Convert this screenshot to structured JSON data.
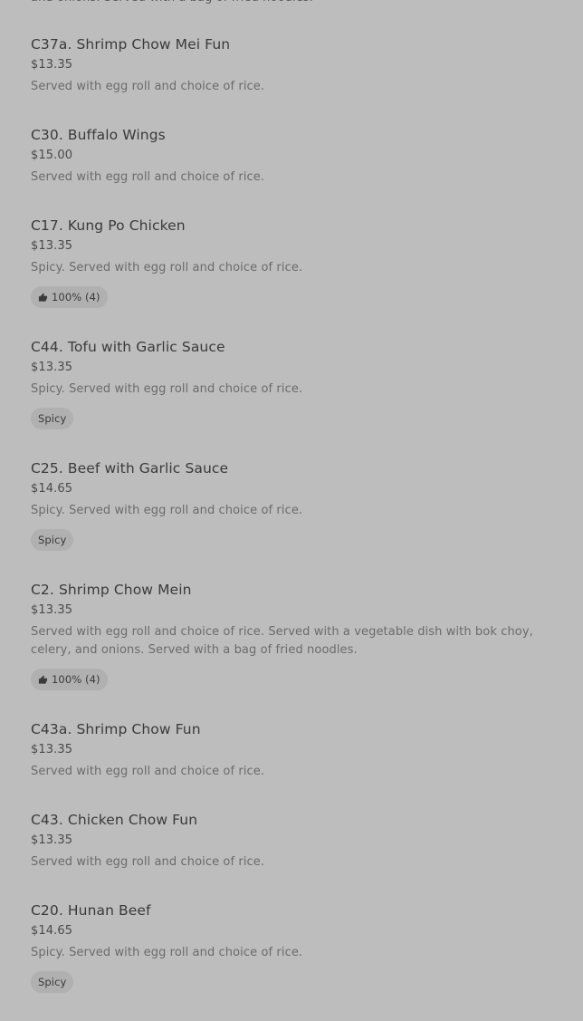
{
  "top_partial_text": "and onions. Served with a bag of fried noodles.",
  "items": [
    {
      "name": "C37a. Shrimp Chow Mei Fun",
      "price": "$13.35",
      "description": "Served with egg roll and choice of rice.",
      "badge": null
    },
    {
      "name": "C30. Buffalo Wings",
      "price": "$15.00",
      "description": "Served with egg roll and choice of rice.",
      "badge": null
    },
    {
      "name": "C17. Kung Po Chicken",
      "price": "$13.35",
      "description": "Spicy. Served with egg roll and choice of rice.",
      "badge": {
        "type": "rating",
        "icon": "thumbs-up-icon",
        "label": "100% (4)"
      }
    },
    {
      "name": "C44. Tofu with Garlic Sauce",
      "price": "$13.35",
      "description": "Spicy. Served with egg roll and choice of rice.",
      "badge": {
        "type": "tag",
        "label": "Spicy"
      }
    },
    {
      "name": "C25. Beef with Garlic Sauce",
      "price": "$14.65",
      "description": "Spicy. Served with egg roll and choice of rice.",
      "badge": {
        "type": "tag",
        "label": "Spicy"
      }
    },
    {
      "name": "C2. Shrimp Chow Mein",
      "price": "$13.35",
      "description": "Served with egg roll and choice of rice. Served with a vegetable dish with bok choy, celery, and onions. Served with a bag of fried noodles.",
      "badge": {
        "type": "rating",
        "icon": "thumbs-up-icon",
        "label": "100% (4)"
      }
    },
    {
      "name": "C43a. Shrimp Chow Fun",
      "price": "$13.35",
      "description": "Served with egg roll and choice of rice.",
      "badge": null
    },
    {
      "name": "C43. Chicken Chow Fun",
      "price": "$13.35",
      "description": "Served with egg roll and choice of rice.",
      "badge": null
    },
    {
      "name": "C20. Hunan Beef",
      "price": "$14.65",
      "description": "Spicy. Served with egg roll and choice of rice.",
      "badge": {
        "type": "tag",
        "label": "Spicy"
      }
    }
  ]
}
